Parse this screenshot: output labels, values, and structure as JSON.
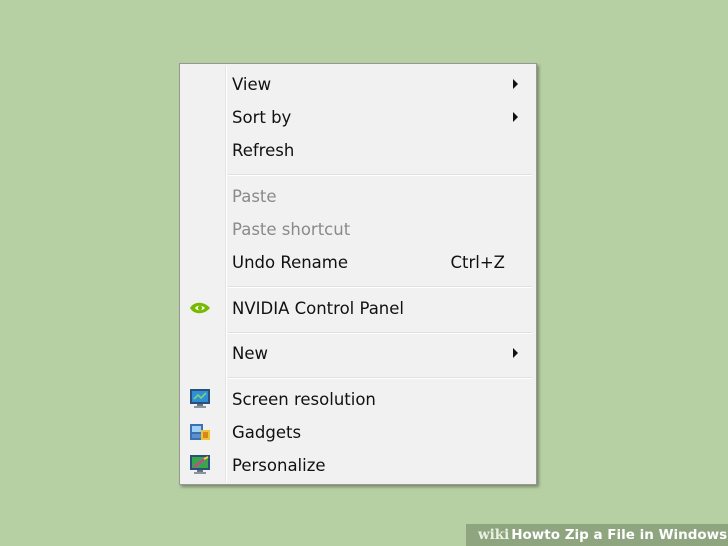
{
  "context_menu": {
    "items": [
      {
        "label": "View",
        "submenu": true
      },
      {
        "label": "Sort by",
        "submenu": true
      },
      {
        "label": "Refresh"
      },
      {
        "label": "Paste",
        "disabled": true
      },
      {
        "label": "Paste shortcut",
        "disabled": true
      },
      {
        "label": "Undo Rename",
        "shortcut": "Ctrl+Z"
      },
      {
        "label": "NVIDIA Control Panel",
        "icon": "nvidia-icon"
      },
      {
        "label": "New",
        "submenu": true
      },
      {
        "label": "Screen resolution",
        "icon": "monitor-icon"
      },
      {
        "label": "Gadgets",
        "icon": "gadgets-icon"
      },
      {
        "label": "Personalize",
        "icon": "personalize-icon"
      }
    ]
  },
  "watermark": {
    "brand_prefix": "wiki",
    "brand_suffix": "How",
    "title": " to Zip a File in Windows XP"
  },
  "colors": {
    "desktop_background": "#b7d0a3",
    "menu_background": "#f1f1f1",
    "disabled_text": "#8a8a8a",
    "nvidia_green": "#76b900"
  }
}
